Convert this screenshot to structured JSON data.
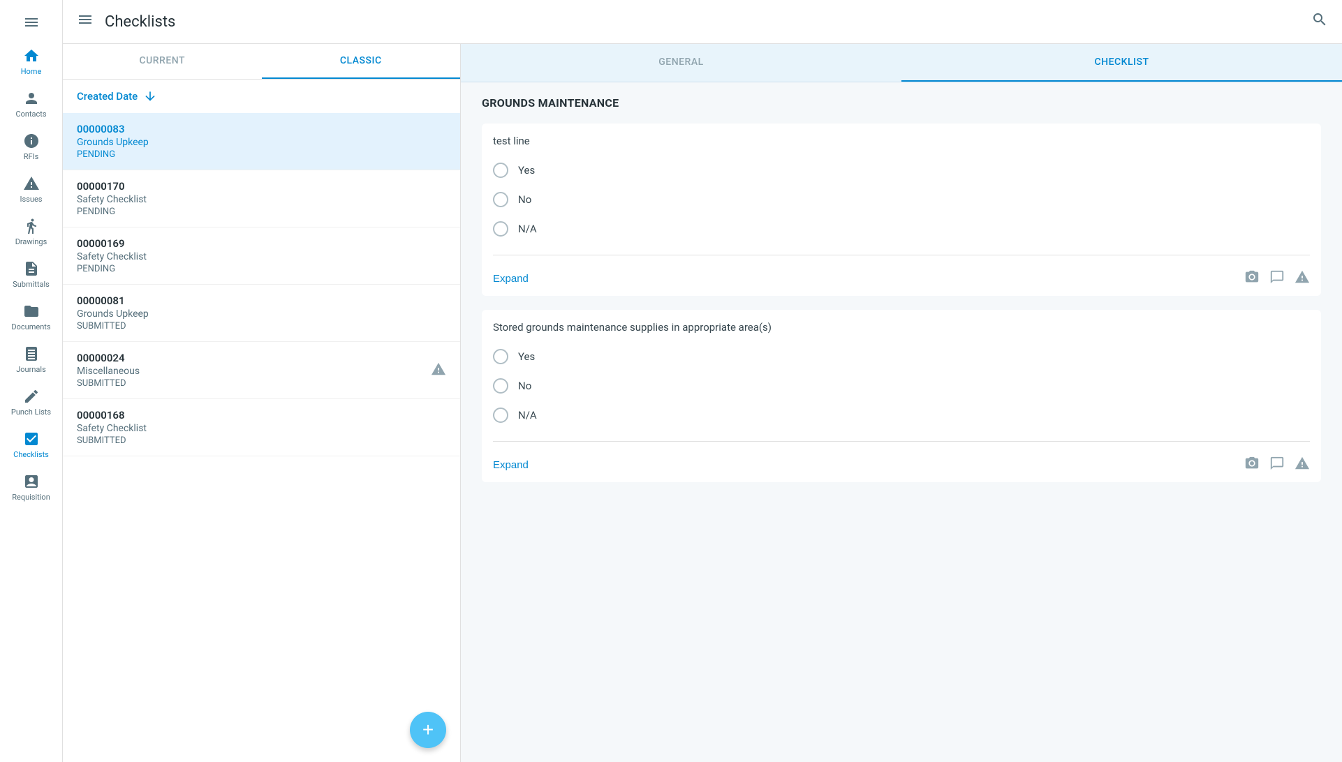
{
  "app": {
    "title": "Checklists"
  },
  "sidebar": {
    "items": [
      {
        "id": "home",
        "label": "Home",
        "icon": "home"
      },
      {
        "id": "contacts",
        "label": "Contacts",
        "icon": "person"
      },
      {
        "id": "rfis",
        "label": "RFIs",
        "icon": "info"
      },
      {
        "id": "issues",
        "label": "Issues",
        "icon": "warning"
      },
      {
        "id": "drawings",
        "label": "Drawings",
        "icon": "straighten"
      },
      {
        "id": "submittals",
        "label": "Submittals",
        "icon": "description"
      },
      {
        "id": "documents",
        "label": "Documents",
        "icon": "folder"
      },
      {
        "id": "journals",
        "label": "Journals",
        "icon": "book"
      },
      {
        "id": "punchlists",
        "label": "Punch Lists",
        "icon": "edit"
      },
      {
        "id": "checklists",
        "label": "Checklists",
        "icon": "checklist"
      },
      {
        "id": "requisition",
        "label": "Requisition",
        "icon": "receipt"
      }
    ]
  },
  "left_panel": {
    "tabs": [
      {
        "id": "current",
        "label": "CURRENT"
      },
      {
        "id": "classic",
        "label": "CLASSIC"
      }
    ],
    "active_tab": "classic",
    "sort_label": "Created Date",
    "items": [
      {
        "id": "00000083",
        "name": "Grounds Upkeep",
        "status": "PENDING",
        "selected": true,
        "highlighted": true,
        "has_warning": false
      },
      {
        "id": "00000170",
        "name": "Safety Checklist",
        "status": "PENDING",
        "selected": false,
        "highlighted": false,
        "has_warning": false
      },
      {
        "id": "00000169",
        "name": "Safety Checklist",
        "status": "PENDING",
        "selected": false,
        "highlighted": false,
        "has_warning": false
      },
      {
        "id": "00000081",
        "name": "Grounds Upkeep",
        "status": "SUBMITTED",
        "selected": false,
        "highlighted": false,
        "has_warning": false
      },
      {
        "id": "00000024",
        "name": "Miscellaneous",
        "status": "SUBMITTED",
        "selected": false,
        "highlighted": false,
        "has_warning": true
      },
      {
        "id": "00000168",
        "name": "Safety Checklist",
        "status": "SUBMITTED",
        "selected": false,
        "highlighted": false,
        "has_warning": false
      }
    ],
    "fab_label": "+"
  },
  "right_panel": {
    "tabs": [
      {
        "id": "general",
        "label": "GENERAL"
      },
      {
        "id": "checklist",
        "label": "CHECKLIST"
      }
    ],
    "active_tab": "checklist",
    "section_title": "GROUNDS MAINTENANCE",
    "checklist_blocks": [
      {
        "question": "test line",
        "options": [
          "Yes",
          "No",
          "N/A"
        ],
        "expand_label": "Expand"
      },
      {
        "question": "Stored grounds maintenance supplies in appropriate area(s)",
        "options": [
          "Yes",
          "No",
          "N/A"
        ],
        "expand_label": "Expand"
      }
    ]
  }
}
